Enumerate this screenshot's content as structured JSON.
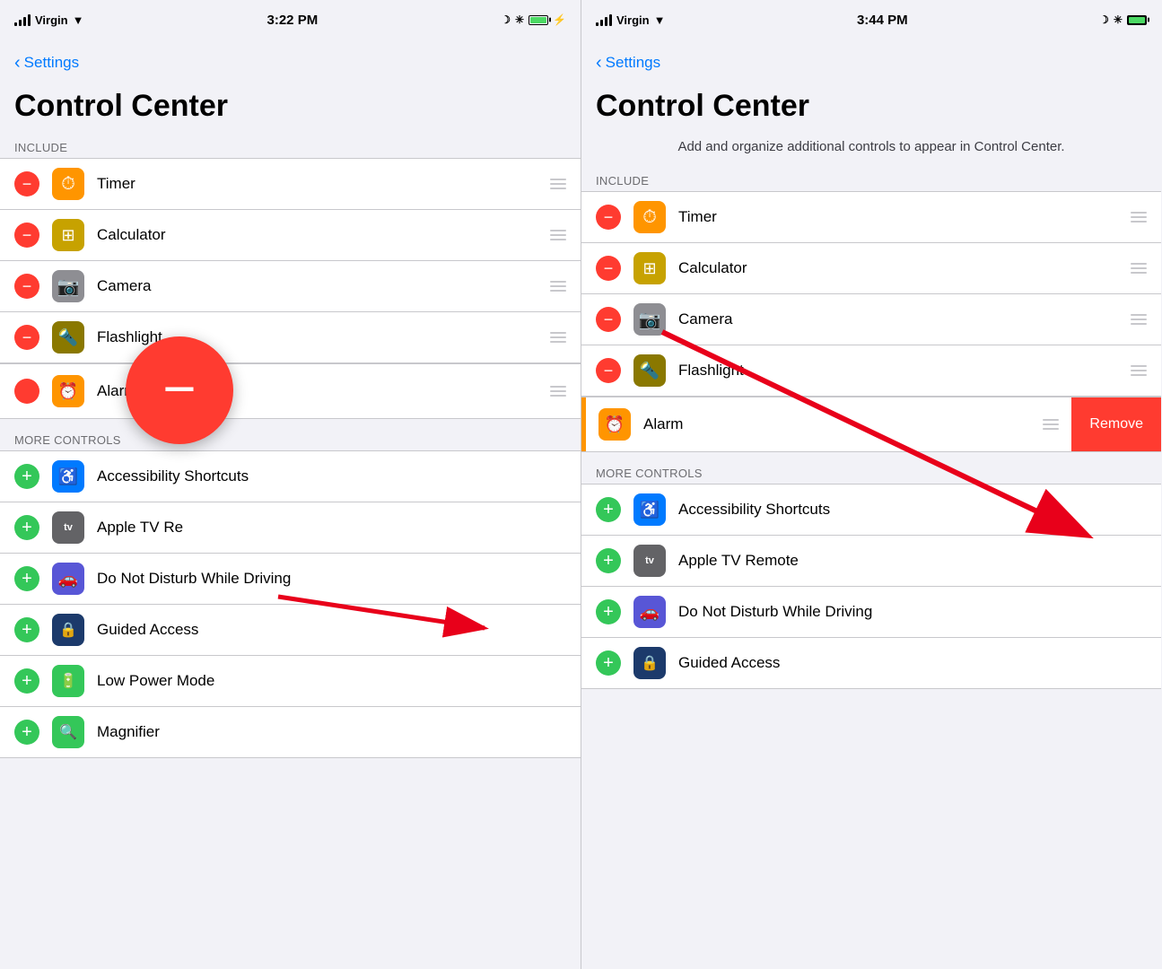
{
  "left_panel": {
    "status": {
      "carrier": "Virgin",
      "time": "3:22 PM",
      "signal": true,
      "wifi": true,
      "battery_full": true
    },
    "nav": {
      "back_label": "Settings"
    },
    "title": "Control Center",
    "section_include": "INCLUDE",
    "include_items": [
      {
        "id": "timer",
        "label": "Timer",
        "icon_char": "⏱",
        "icon_class": "icon-orange"
      },
      {
        "id": "calculator",
        "label": "Calculator",
        "icon_char": "🖩",
        "icon_class": "icon-gold"
      },
      {
        "id": "camera",
        "label": "Camera",
        "icon_char": "📷",
        "icon_class": "icon-gray"
      },
      {
        "id": "flashlight",
        "label": "Flashlight",
        "icon_char": "🔦",
        "icon_class": "icon-olive"
      }
    ],
    "alarm_label": "Alarm",
    "section_more": "MORE CONTROLS",
    "more_items": [
      {
        "id": "accessibility",
        "label": "Accessibility Shortcuts",
        "icon_char": "♿",
        "icon_class": "icon-blue"
      },
      {
        "id": "appletv",
        "label": "Apple TV Remote",
        "icon_char": "tv",
        "icon_class": "icon-dark-gray"
      },
      {
        "id": "dnd-driving",
        "label": "Do Not Disturb While Driving",
        "icon_char": "🚗",
        "icon_class": "icon-purple"
      },
      {
        "id": "guided-access",
        "label": "Guided Access",
        "icon_char": "🔒",
        "icon_class": "icon-dark-blue"
      },
      {
        "id": "low-power",
        "label": "Low Power Mode",
        "icon_char": "🔋",
        "icon_class": "icon-green"
      },
      {
        "id": "magnifier",
        "label": "Magnifier",
        "icon_char": "🔍",
        "icon_class": "icon-green"
      }
    ]
  },
  "right_panel": {
    "status": {
      "carrier": "Virgin",
      "time": "3:44 PM",
      "signal": true,
      "wifi": true,
      "battery_full": true
    },
    "nav": {
      "back_label": "Settings"
    },
    "title": "Control Center",
    "subtitle": "Add and organize additional controls to appear in Control Center.",
    "section_include": "INCLUDE",
    "include_items": [
      {
        "id": "timer",
        "label": "Timer",
        "icon_char": "⏱",
        "icon_class": "icon-orange"
      },
      {
        "id": "calculator",
        "label": "Calculator",
        "icon_char": "🖩",
        "icon_class": "icon-gold"
      },
      {
        "id": "camera",
        "label": "Camera",
        "icon_char": "📷",
        "icon_class": "icon-gray"
      },
      {
        "id": "flashlight",
        "label": "Flashlight",
        "icon_char": "🔦",
        "icon_class": "icon-olive"
      }
    ],
    "alarm_label": "Alarm",
    "remove_label": "Remove",
    "section_more": "MORE CONTROLS",
    "more_items": [
      {
        "id": "accessibility",
        "label": "Accessibility Shortcuts",
        "icon_char": "♿",
        "icon_class": "icon-blue"
      },
      {
        "id": "appletv",
        "label": "Apple TV Remote",
        "icon_char": "tv",
        "icon_class": "icon-dark-gray"
      },
      {
        "id": "dnd-driving",
        "label": "Do Not Disturb While Driving",
        "icon_char": "🚗",
        "icon_class": "icon-purple"
      },
      {
        "id": "guided-access",
        "label": "Guided Access",
        "icon_char": "🔒",
        "icon_class": "icon-dark-blue"
      }
    ]
  }
}
